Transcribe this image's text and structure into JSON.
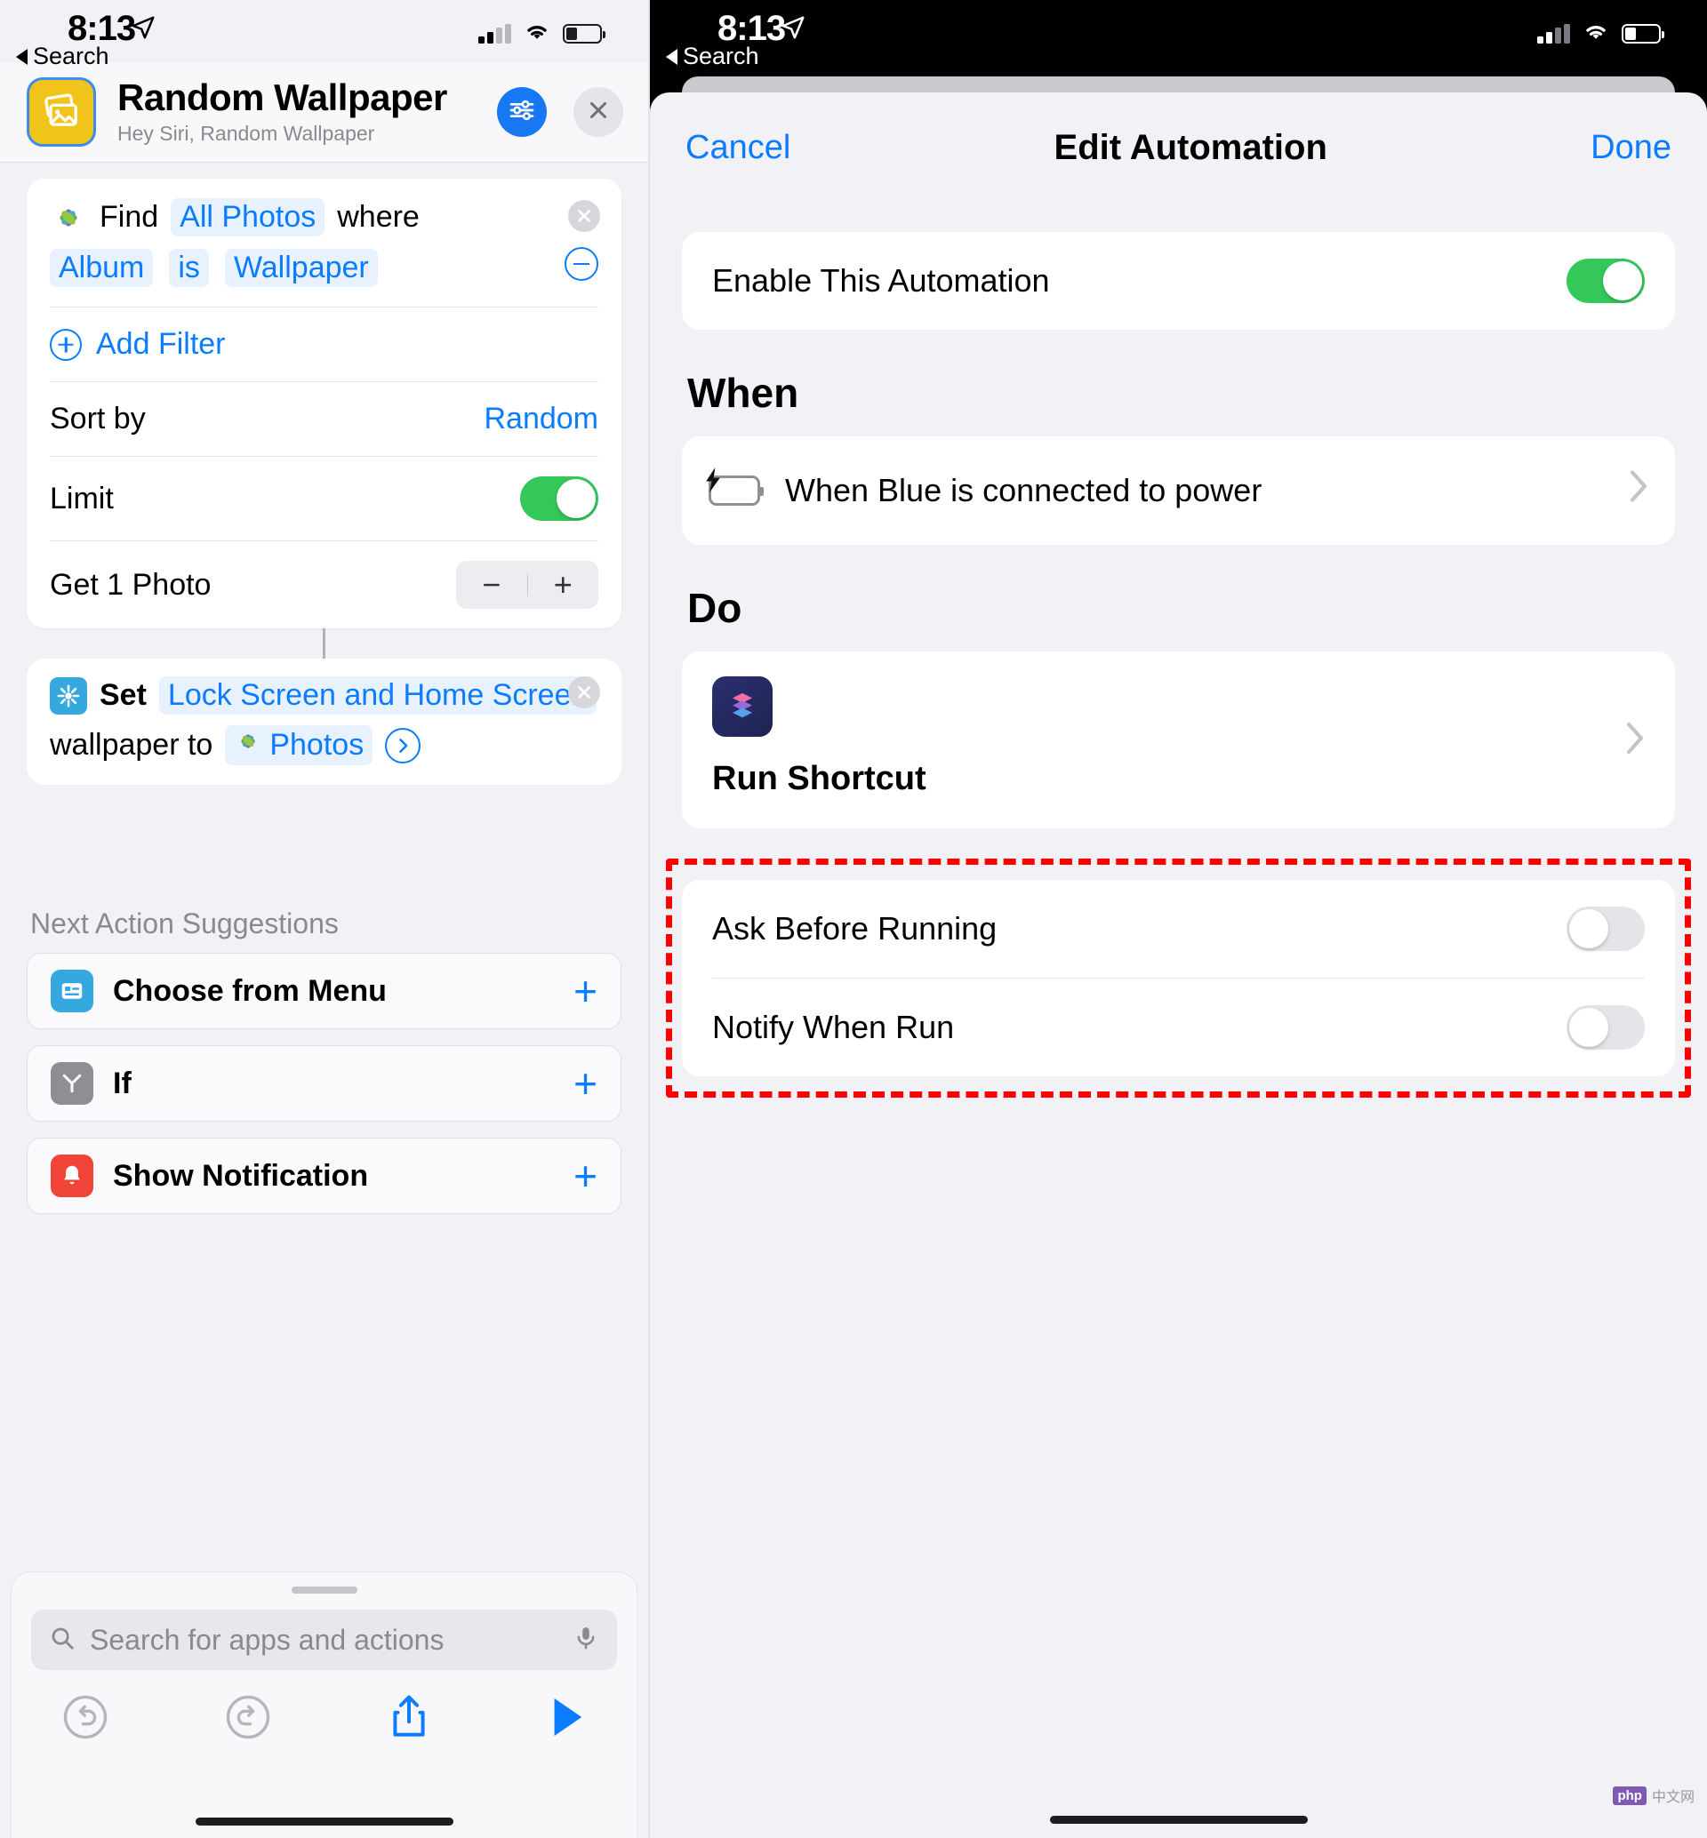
{
  "left": {
    "status": {
      "time": "8:13",
      "back_label": "Search"
    },
    "header": {
      "title": "Random Wallpaper",
      "subtitle": "Hey Siri, Random Wallpaper",
      "settings_icon": "sliders-icon",
      "close_icon": "close-icon"
    },
    "find_action": {
      "icon": "photos-app-icon",
      "verb": "Find",
      "source": "All Photos",
      "where": "where",
      "filter_field": "Album",
      "filter_op": "is",
      "filter_value": "Wallpaper",
      "remove_icon": "remove-filter-icon",
      "close_icon": "close-icon",
      "add_filter_label": "Add Filter",
      "sort_by_label": "Sort by",
      "sort_by_value": "Random",
      "limit_label": "Limit",
      "limit_enabled": true,
      "count_label": "Get 1 Photo",
      "minus_label": "−",
      "plus_label": "+"
    },
    "set_action": {
      "icon": "wallpaper-app-icon",
      "verb": "Set",
      "target": "Lock Screen and Home Screen",
      "mid_text": "wallpaper to",
      "value_icon": "photos-app-icon",
      "value": "Photos",
      "chevron_icon": "chevron-right-icon",
      "close_icon": "close-icon"
    },
    "suggestions": {
      "title": "Next Action Suggestions",
      "items": [
        {
          "label": "Choose from Menu",
          "icon": "menu-action-icon",
          "icon_color": "#35a8e0",
          "add_label": "+"
        },
        {
          "label": "If",
          "icon": "if-action-icon",
          "icon_color": "#8e8e93",
          "add_label": "+"
        },
        {
          "label": "Show Notification",
          "icon": "notification-action-icon",
          "icon_color": "#f04438",
          "add_label": "+"
        }
      ]
    },
    "search": {
      "placeholder": "Search for apps and actions",
      "search_icon": "search-icon",
      "mic_icon": "microphone-icon"
    },
    "toolbar": {
      "undo_icon": "undo-icon",
      "redo_icon": "redo-icon",
      "share_icon": "share-icon",
      "play_icon": "play-icon"
    }
  },
  "right": {
    "status": {
      "time": "8:13",
      "back_label": "Search"
    },
    "nav": {
      "cancel": "Cancel",
      "title": "Edit Automation",
      "done": "Done"
    },
    "enable": {
      "label": "Enable This Automation",
      "on": true
    },
    "when": {
      "section_title": "When",
      "trigger_label": "When Blue is connected to power",
      "trigger_icon": "battery-charging-icon",
      "chevron_icon": "chevron-right-icon"
    },
    "do": {
      "section_title": "Do",
      "action_label": "Run Shortcut",
      "action_icon": "shortcuts-app-icon",
      "chevron_icon": "chevron-right-icon"
    },
    "options": {
      "highlight_color": "#ff0000",
      "rows": [
        {
          "label": "Ask Before Running",
          "on": false
        },
        {
          "label": "Notify When Run",
          "on": false
        }
      ]
    },
    "watermark": {
      "badge": "php",
      "text": "中文网"
    }
  }
}
